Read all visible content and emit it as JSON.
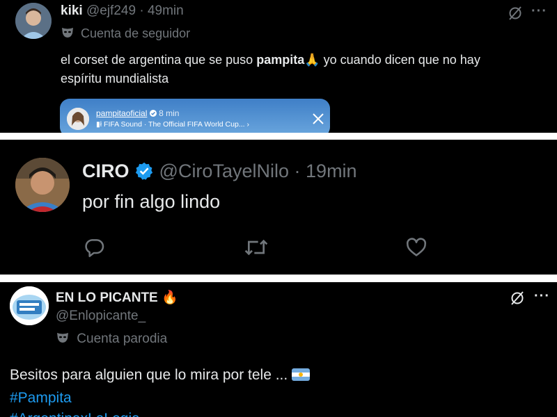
{
  "tweet1": {
    "display_name": "kiki",
    "handle": "@ejf249",
    "separator": "·",
    "time": "49min",
    "account_label": "Cuenta de seguidor",
    "text_before": "el corset de argentina que se puso ",
    "text_bold": "pampita",
    "text_emoji": "🙏",
    "text_after": " yo cuando dicen que no hay",
    "text_line2": "espíritu mundialista",
    "embed": {
      "account": "pampitaoficial",
      "time": "8 min",
      "music": "FIFA Sound · The Official FIFA World Cup... ›"
    }
  },
  "tweet2": {
    "display_name": "CIRO",
    "handle": "@CiroTayelNilo",
    "separator": "·",
    "time": "19min",
    "text": "por fin algo lindo"
  },
  "tweet3": {
    "display_name": "EN LO PICANTE",
    "name_emoji": "🔥",
    "handle": "@Enlopicante_",
    "account_label": "Cuenta parodia",
    "text": "Besitos para alguien que lo mira por tele ...",
    "hashtag1": "#Pampita",
    "hashtag2": "#ArgentinaxLaLegia"
  },
  "icons": {
    "grok": "grok-icon",
    "more": "more-icon",
    "reply": "reply-icon",
    "retweet": "retweet-icon",
    "like": "like-icon",
    "mask": "mask-icon",
    "verified": "verified-badge-icon",
    "close": "close-icon",
    "music": "music-icon"
  },
  "colors": {
    "background": "#000000",
    "text": "#e7e9ea",
    "muted": "#71767b",
    "link": "#1d9bf0",
    "verified": "#1d9bf0"
  }
}
